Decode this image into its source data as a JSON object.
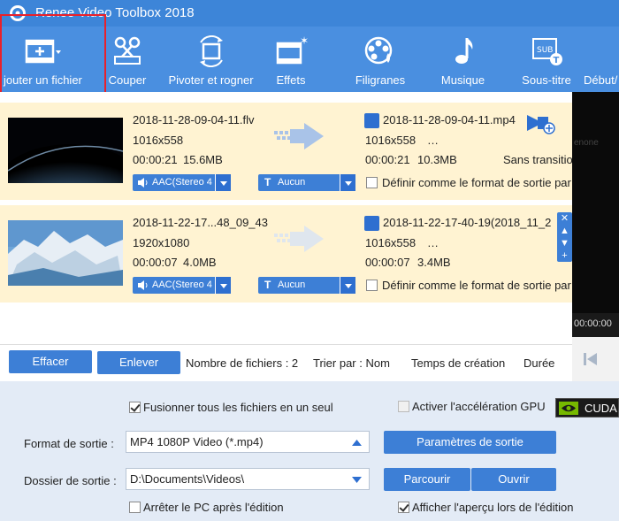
{
  "window": {
    "title": "Renee Video Toolbox 2018"
  },
  "toolbar": {
    "items": [
      {
        "label": "jouter un fichier",
        "icon": "add-file-icon"
      },
      {
        "label": "Couper",
        "icon": "scissors-icon"
      },
      {
        "label": "Pivoter et rogner",
        "icon": "rotate-crop-icon"
      },
      {
        "label": "Effets",
        "icon": "effects-icon"
      },
      {
        "label": "Filigranes",
        "icon": "watermark-icon"
      },
      {
        "label": "Musique",
        "icon": "music-icon"
      },
      {
        "label": "Sous-titre",
        "icon": "subtitle-icon"
      },
      {
        "label": "Début/",
        "icon": "start-end-icon"
      }
    ]
  },
  "files": [
    {
      "source_name": "2018-11-28-09-04-11.flv",
      "source_res": "1016x558",
      "source_dur": "00:00:21",
      "source_size": "15.6MB",
      "output_name": "2018-11-28-09-04-11.mp4",
      "output_res": "1016x558",
      "output_extra": "…",
      "output_dur": "00:00:21",
      "output_size": "10.3MB",
      "transition": "Sans transitio",
      "audio": "AAC(Stereo 4",
      "subtitle": "Aucun",
      "default_format_label": "Définir comme le format de sortie par"
    },
    {
      "source_name": "2018-11-22-17...48_09_43",
      "source_res": "1920x1080",
      "source_dur": "00:00:07",
      "source_size": "4.0MB",
      "output_name": "2018-11-22-17-40-19(2018_11_2",
      "output_res": "1016x558",
      "output_extra": "…",
      "output_dur": "00:00:07",
      "output_size": "3.4MB",
      "audio": "AAC(Stereo 4",
      "subtitle": "Aucun",
      "default_format_label": "Définir comme le format de sortie par"
    }
  ],
  "preview": {
    "watermark_text": "enone",
    "time": "00:00:00"
  },
  "actions": {
    "clear_label": "Effacer",
    "remove_label": "Enlever",
    "file_count": "Nombre de fichiers : 2",
    "sort_label": "Trier par : Nom",
    "sort_creation": "Temps de création",
    "sort_duration": "Durée"
  },
  "settings": {
    "merge_label": "Fusionner tous les fichiers en un seul",
    "merge_checked": true,
    "gpu_label": "Activer l'accélération GPU",
    "gpu_checked": false,
    "cuda_label": "CUDA",
    "format_label": "Format de sortie :",
    "format_value": "MP4 1080P Video (*.mp4)",
    "params_button": "Paramètres de sortie",
    "folder_label": "Dossier de sortie :",
    "folder_value": "D:\\Documents\\Videos\\",
    "browse_button": "Parcourir",
    "open_button": "Ouvrir",
    "shutdown_label": "Arrêter le PC après l'édition",
    "preview_label": "Afficher l'aperçu lors de l'édition"
  },
  "colors": {
    "toolbar": "#4a8fe0",
    "row_bg": "#fff3d2",
    "accent": "#3d7fd6",
    "highlight": "#e8212b"
  }
}
